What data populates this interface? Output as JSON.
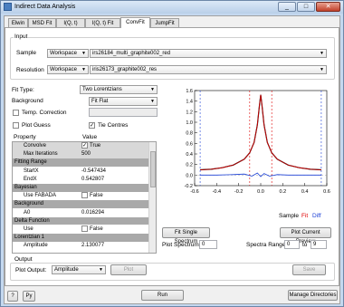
{
  "window": {
    "title": "Indirect Data Analysis",
    "buttons": [
      "_",
      "□",
      "✕"
    ]
  },
  "tabs": [
    "Elwin",
    "MSD Fit",
    "I(Q, t)",
    "I(Q, t) Fit",
    "ConvFit",
    "JumpFit"
  ],
  "input": {
    "group_title": "Input",
    "sample_label": "Sample",
    "sample_source": "Workspace",
    "sample_value": "irs26184_multi_graphite002_red",
    "resolution_label": "Resolution",
    "resolution_source": "Workspace",
    "resolution_value": "iris26173_graphite002_res"
  },
  "fit": {
    "fit_type_label": "Fit Type:",
    "fit_type_value": "Two Lorentzians",
    "background_label": "Background",
    "background_value": "Fit Flat",
    "temp_correction_label": "Temp. Correction",
    "temp_correction_checked": false,
    "plot_guess_label": "Plot Guess",
    "plot_guess_checked": false,
    "tie_centres_label": "Tie Centres",
    "tie_centres_checked": true
  },
  "properties": {
    "header_property": "Property",
    "header_value": "Value",
    "rows": [
      {
        "name": "Convolve",
        "value": "True",
        "kind": "sub",
        "check": true
      },
      {
        "name": "Max Iterations",
        "value": "500",
        "kind": "sub"
      },
      {
        "name": "Fitting Range",
        "value": "",
        "kind": "group"
      },
      {
        "name": "StartX",
        "value": "-0.547434",
        "kind": "item"
      },
      {
        "name": "EndX",
        "value": "0.542807",
        "kind": "item"
      },
      {
        "name": "Bayesian",
        "value": "",
        "kind": "group"
      },
      {
        "name": "Use FABADA",
        "value": "False",
        "kind": "item",
        "check": false
      },
      {
        "name": "Background",
        "value": "",
        "kind": "group"
      },
      {
        "name": "A0",
        "value": "0.016294",
        "kind": "item"
      },
      {
        "name": "Delta Function",
        "value": "",
        "kind": "group"
      },
      {
        "name": "Use",
        "value": "False",
        "kind": "item",
        "check": false
      },
      {
        "name": "Lorentzian 1",
        "value": "",
        "kind": "group"
      },
      {
        "name": "Amplitude",
        "value": "2.130077",
        "kind": "item"
      }
    ]
  },
  "plot": {
    "legend": [
      "Sample",
      "Fit",
      "Diff"
    ],
    "legend_colors": [
      "#000000",
      "#e00000",
      "#1a3fd6"
    ],
    "y_ticks": [
      "1.6",
      "1.4",
      "1.2",
      "1.0",
      "0.8",
      "0.6",
      "0.4",
      "0.2",
      "0.0",
      "-0.2"
    ],
    "x_ticks": [
      "-0.6",
      "-0.4",
      "-0.2",
      "0.0",
      "0.2",
      "0.4",
      "0.6"
    ]
  },
  "chart_data": {
    "type": "line",
    "ylim": [
      -0.2,
      1.6
    ],
    "xlim": [
      -0.6,
      0.6
    ],
    "series": [
      {
        "name": "Sample",
        "x": [
          -0.55,
          -0.45,
          -0.35,
          -0.25,
          -0.15,
          -0.1,
          -0.06,
          -0.03,
          -0.01,
          0.0,
          0.01,
          0.03,
          0.06,
          0.1,
          0.15,
          0.25,
          0.35,
          0.45,
          0.55
        ],
        "y": [
          0.1,
          0.11,
          0.14,
          0.19,
          0.3,
          0.42,
          0.62,
          0.95,
          1.35,
          1.52,
          1.35,
          0.95,
          0.62,
          0.42,
          0.3,
          0.19,
          0.14,
          0.11,
          0.1
        ]
      },
      {
        "name": "Fit",
        "x": [
          -0.55,
          -0.45,
          -0.35,
          -0.25,
          -0.15,
          -0.1,
          -0.06,
          -0.03,
          -0.01,
          0.0,
          0.01,
          0.03,
          0.06,
          0.1,
          0.15,
          0.25,
          0.35,
          0.45,
          0.55
        ],
        "y": [
          0.1,
          0.11,
          0.14,
          0.19,
          0.3,
          0.42,
          0.62,
          0.95,
          1.35,
          1.52,
          1.35,
          0.95,
          0.62,
          0.42,
          0.3,
          0.19,
          0.14,
          0.11,
          0.1
        ]
      },
      {
        "name": "Diff",
        "x": [
          -0.55,
          -0.4,
          -0.25,
          -0.15,
          -0.08,
          -0.03,
          0.0,
          0.03,
          0.08,
          0.15,
          0.25,
          0.4,
          0.55
        ],
        "y": [
          0.0,
          0.0,
          0.01,
          0.02,
          -0.02,
          0.04,
          -0.03,
          0.03,
          -0.02,
          0.01,
          0.0,
          0.0,
          0.0
        ]
      }
    ],
    "range_markers_blue": [
      -0.55,
      0.55
    ],
    "range_markers_red": [
      -0.1,
      0.1
    ]
  },
  "plot_controls": {
    "fit_single_label": "Fit Single Spectrum",
    "plot_preview_label": "Plot Current Preview",
    "plot_spectrum_label": "Plot Spectrum:",
    "plot_spectrum_value": "0",
    "spectra_range_label": "Spectra Range:",
    "spectra_from": "0",
    "spectra_to_label": "to",
    "spectra_to": "9"
  },
  "output": {
    "group_title": "Output",
    "plot_output_label": "Plot Output:",
    "plot_output_value": "Amplitude",
    "plot_button": "Plot",
    "save_button": "Save"
  },
  "bottom": {
    "help_label": "?",
    "py_label": "Py",
    "run_label": "Run",
    "manage_label": "Manage Directories"
  }
}
